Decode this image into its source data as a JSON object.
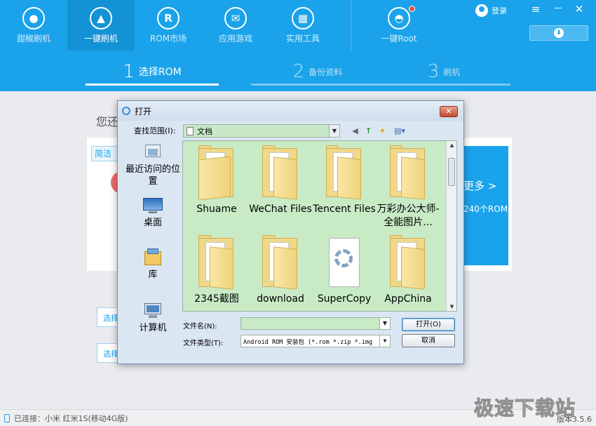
{
  "nav": {
    "items": [
      {
        "label": "甜椒刷机",
        "icon": "pepper-icon",
        "glyph": "●"
      },
      {
        "label": "一键刷机",
        "icon": "cursor-icon",
        "glyph": "▲"
      },
      {
        "label": "ROM市场",
        "icon": "rom-icon",
        "glyph": "R"
      },
      {
        "label": "应用游戏",
        "icon": "message-icon",
        "glyph": "✉"
      },
      {
        "label": "实用工具",
        "icon": "tools-icon",
        "glyph": "▦"
      }
    ],
    "root": {
      "label": "一键Root",
      "icon": "android-icon",
      "glyph": "◓"
    },
    "active_index": 1
  },
  "header": {
    "login_label": "登录",
    "menu_glyph": "≡",
    "minimize_glyph": "—",
    "close_glyph": "✕",
    "download_glyph": "⬇"
  },
  "steps": [
    {
      "num": "1",
      "label": "选择ROM",
      "active": true
    },
    {
      "num": "2",
      "label": "备份资料",
      "active": false
    },
    {
      "num": "3",
      "label": "刷机",
      "active": false
    }
  ],
  "background": {
    "title": "您还",
    "tag": "简洁",
    "more": "更多 >",
    "rom_count": "240个ROM",
    "select_btn_1": "选择",
    "select_btn_2": "选择"
  },
  "statusbar": {
    "connection": "已连接：小米 红米1S(移动4G版)",
    "version": "版本3.5.6"
  },
  "watermark": "极速下载站",
  "dialog": {
    "title": "打开",
    "close_glyph": "✕",
    "lookin_label": "查找范围(I):",
    "lookin_value": "文档",
    "toolbar_back": "◀",
    "toolbar_up": "↑",
    "toolbar_newfolder": "✦",
    "toolbar_view": "▤▾",
    "places": [
      {
        "label": "最近访问的位置"
      },
      {
        "label": "桌面"
      },
      {
        "label": "库"
      },
      {
        "label": "计算机"
      }
    ],
    "files": [
      {
        "name": "Shuame",
        "kind": "folder"
      },
      {
        "name": "WeChat Files",
        "kind": "folder"
      },
      {
        "name": "Tencent Files",
        "kind": "folder"
      },
      {
        "name": "万彩办公大师-全能图片...",
        "kind": "folder"
      },
      {
        "name": "2345截图",
        "kind": "folder"
      },
      {
        "name": "download",
        "kind": "folder"
      },
      {
        "name": "SuperCopy",
        "kind": "special"
      },
      {
        "name": "AppChina",
        "kind": "folder"
      }
    ],
    "filename_label": "文件名(N):",
    "filename_value": "",
    "filetype_label": "文件类型(T):",
    "filetype_value": "Android ROM 安装包 (*.rom *.zip *.img",
    "open_button": "打开(O)",
    "cancel_button": "取消"
  },
  "colors": {
    "accent": "#1aa3ea",
    "pane_bg": "#c8ebc6",
    "folder": "#f0d88a"
  }
}
